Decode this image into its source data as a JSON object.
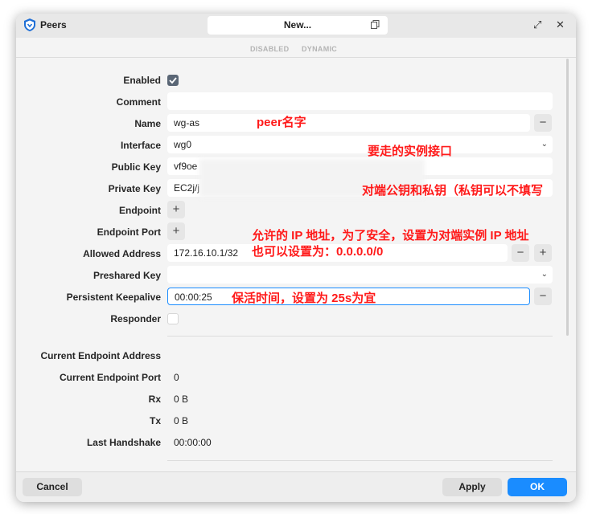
{
  "window": {
    "title": "Peers",
    "name_field": "New...",
    "status_disabled": "DISABLED",
    "status_dynamic": "DYNAMIC"
  },
  "form": {
    "enabled": {
      "label": "Enabled",
      "checked": true
    },
    "comment": {
      "label": "Comment",
      "value": ""
    },
    "name": {
      "label": "Name",
      "value": "wg-as"
    },
    "interface": {
      "label": "Interface",
      "value": "wg0"
    },
    "public_key": {
      "label": "Public Key",
      "value": "vf9oe"
    },
    "private_key": {
      "label": "Private Key",
      "value": "EC2j/j"
    },
    "endpoint": {
      "label": "Endpoint"
    },
    "endpoint_port": {
      "label": "Endpoint Port"
    },
    "allowed_address": {
      "label": "Allowed Address",
      "value": "172.16.10.1/32"
    },
    "preshared_key": {
      "label": "Preshared Key",
      "value": ""
    },
    "persistent_keepalive": {
      "label": "Persistent Keepalive",
      "value": "00:00:25"
    },
    "responder": {
      "label": "Responder",
      "checked": false
    }
  },
  "status": {
    "current_endpoint_address": {
      "label": "Current Endpoint Address",
      "value": ""
    },
    "current_endpoint_port": {
      "label": "Current Endpoint Port",
      "value": "0"
    },
    "rx": {
      "label": "Rx",
      "value": "0 B"
    },
    "tx": {
      "label": "Tx",
      "value": "0 B"
    },
    "last_handshake": {
      "label": "Last Handshake",
      "value": "00:00:00"
    }
  },
  "annotations": {
    "name_note": "peer名字",
    "interface_note": "要走的实例接口",
    "keys_note": "对端公钥和私钥（私钥可以不填写",
    "allowed_note_1": "允许的 IP 地址，为了安全，设置为对端实例 IP 地址",
    "allowed_note_2": "也可以设置为：0.0.0.0/0",
    "keepalive_note": "保活时间，设置为 25s为宜"
  },
  "footer": {
    "cancel": "Cancel",
    "apply": "Apply",
    "ok": "OK"
  },
  "colors": {
    "accent": "#1a8cff",
    "annotation": "#ff1a1a",
    "checkbox": "#5a6675"
  }
}
